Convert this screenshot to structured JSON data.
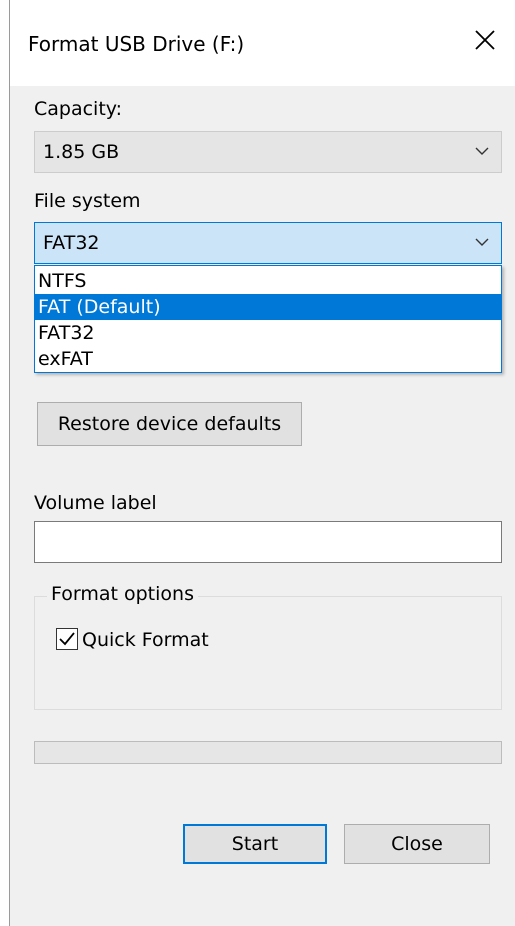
{
  "window": {
    "title": "Format USB Drive (F:)"
  },
  "capacity": {
    "label": "Capacity:",
    "value": "1.85 GB"
  },
  "file_system": {
    "label": "File system",
    "value": "FAT32",
    "options": [
      "NTFS",
      "FAT (Default)",
      "FAT32",
      "exFAT"
    ],
    "highlighted_option": "FAT (Default)"
  },
  "buttons": {
    "restore_defaults": "Restore device defaults",
    "start": "Start",
    "close": "Close"
  },
  "volume": {
    "label": "Volume label",
    "value": ""
  },
  "format_options": {
    "label": "Format options",
    "quick_format": {
      "label": "Quick Format",
      "checked": true
    }
  },
  "progress": {
    "value": 0
  },
  "colors": {
    "accent": "#0078d7",
    "selection": "#0078d7",
    "focus_fill": "#cce4f7"
  }
}
